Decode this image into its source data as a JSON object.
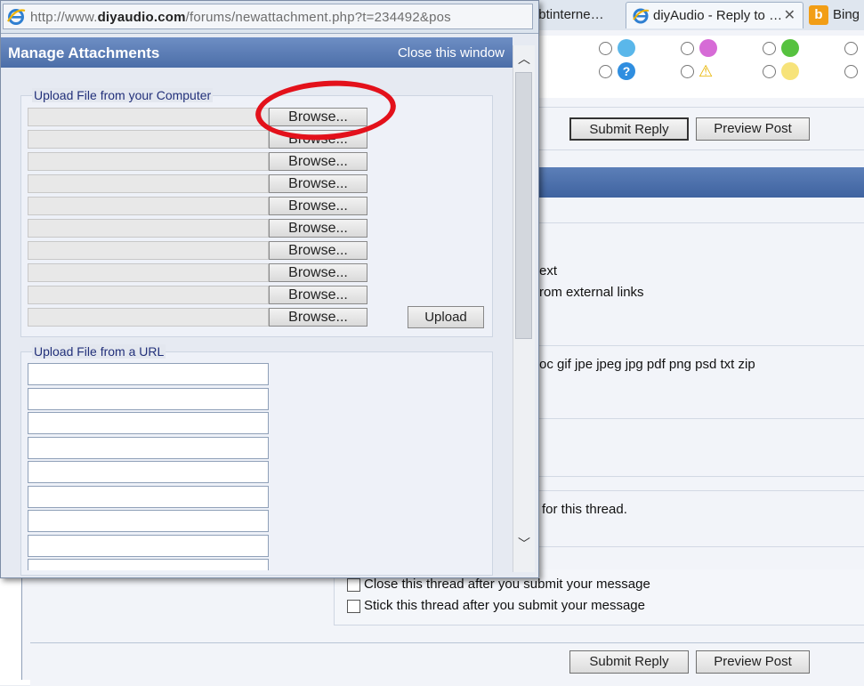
{
  "browser": {
    "popup_url_prefix": "http://www.",
    "popup_url_domain": "diyaudio.com",
    "popup_url_rest": "/forums/newattachment.php?t=234492&pos",
    "tabs": [
      {
        "label": "@btinterne…"
      },
      {
        "label": "diyAudio - Reply to …"
      },
      {
        "label": "Bing"
      }
    ]
  },
  "popup": {
    "title": "Manage Attachments",
    "close_link": "Close this window",
    "upload_computer_legend": "Upload File from your Computer",
    "browse_label": "Browse...",
    "file_rows": 10,
    "upload_button": "Upload",
    "upload_url_legend": "Upload File from a URL",
    "url_rows": 9
  },
  "page": {
    "submit_reply": "Submit Reply",
    "preview_post": "Preview Post",
    "text_ext": "ext",
    "text_links": "rom external links",
    "text_types": "oc gif jpe jpeg jpg pdf png psd txt zip",
    "text_thread": "for this thread.",
    "opt_close": "Close this thread after you submit your message",
    "opt_stick": "Stick this thread after you submit your message"
  },
  "colors": {
    "annotation": "#e3111b",
    "title_bar": "#4b6ea8",
    "legend_text": "#22307a"
  }
}
